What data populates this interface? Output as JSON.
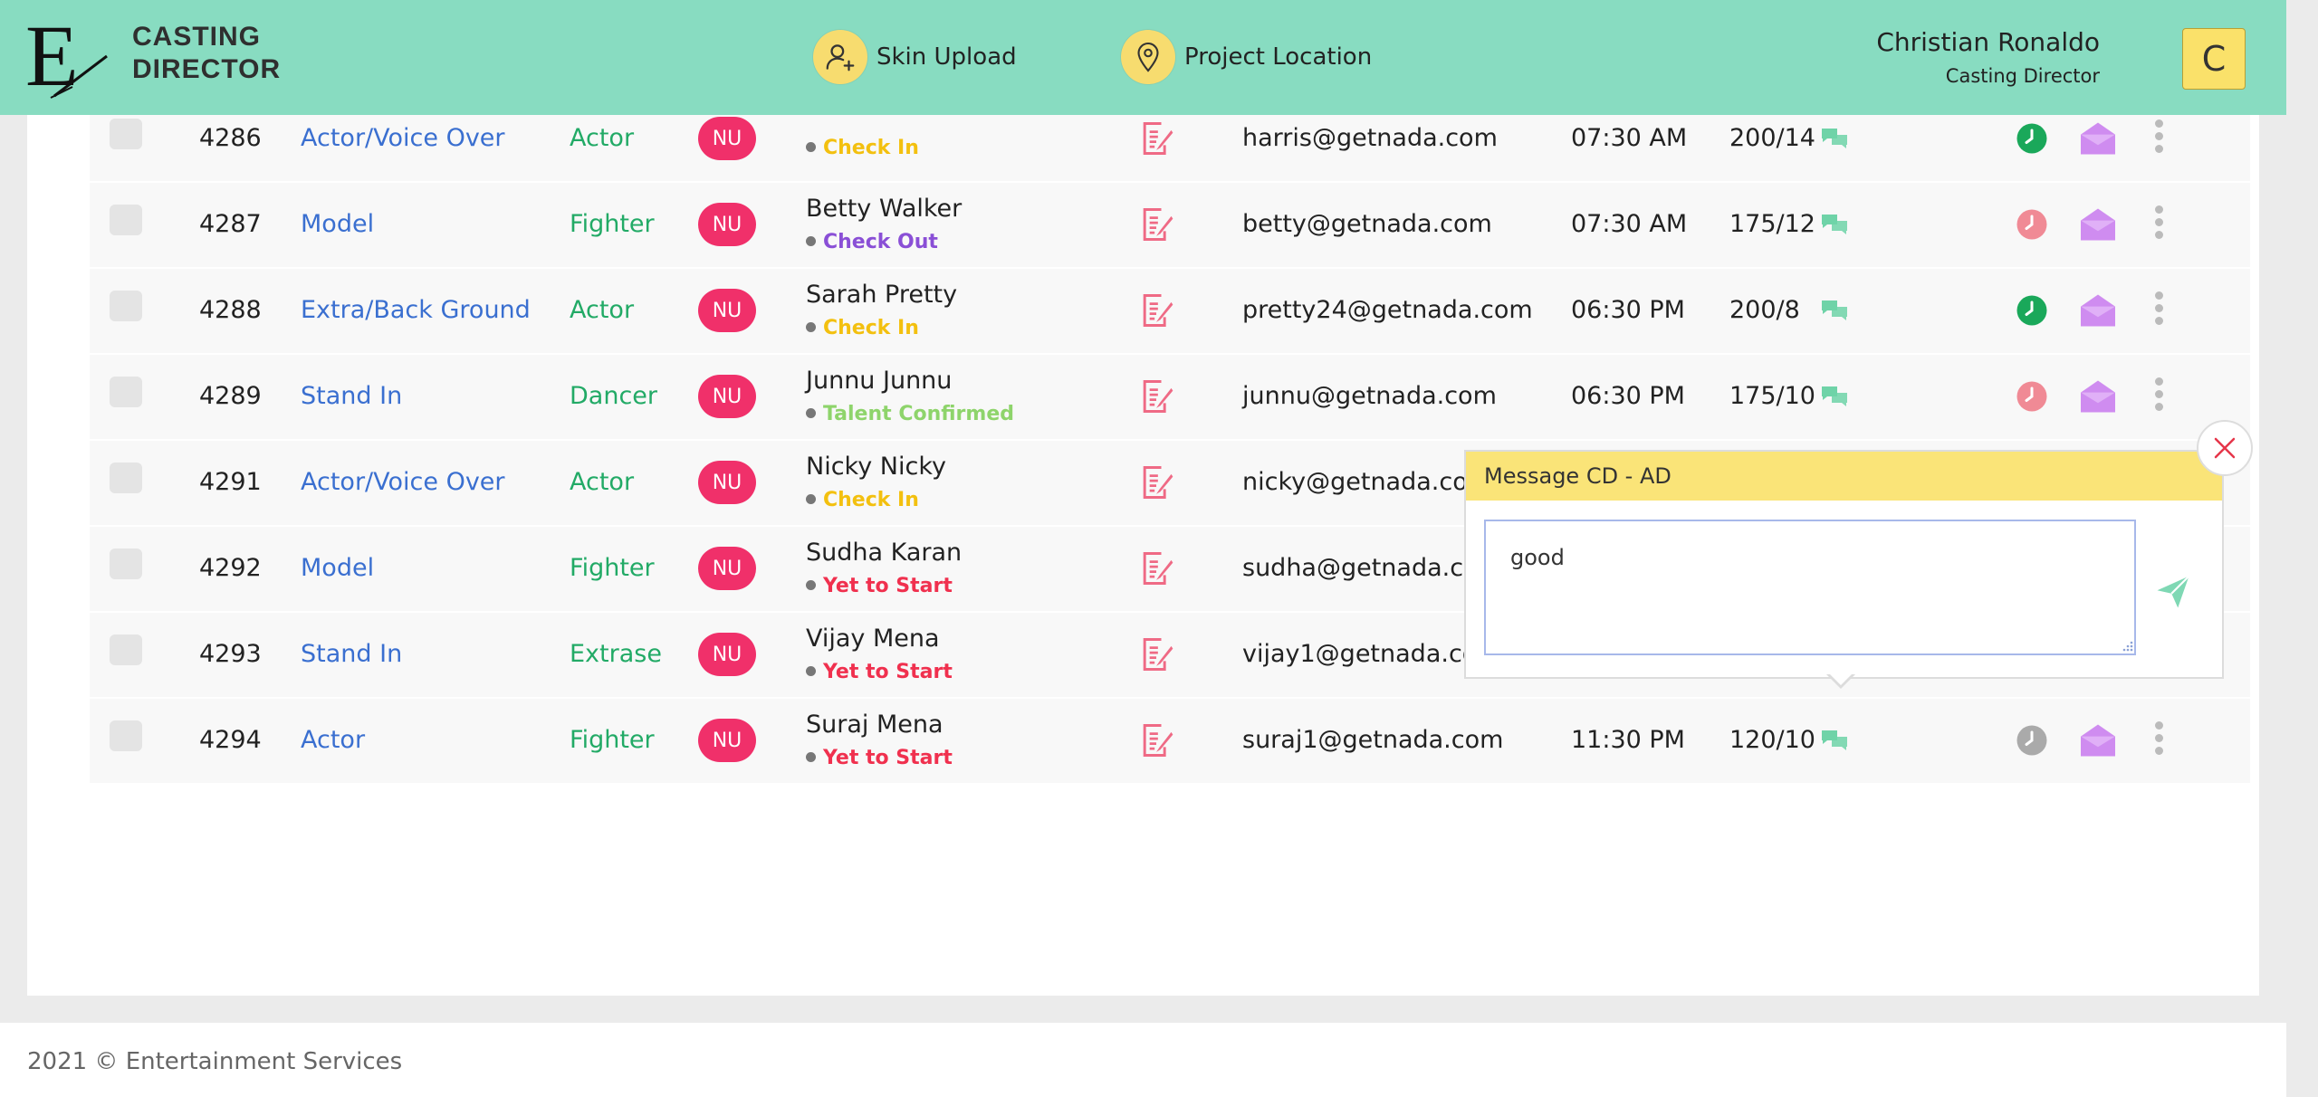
{
  "brand": {
    "logo_letter": "E",
    "line1": "CASTING",
    "line2": "DIRECTOR"
  },
  "nav": {
    "skin_upload": "Skin Upload",
    "project_location": "Project Location"
  },
  "user": {
    "name": "Christian Ronaldo",
    "role": "Casting Director",
    "initial": "C"
  },
  "colors": {
    "header_bg": "#88dcc1",
    "badge": "#f0306a",
    "category": "#3a6fd0",
    "role": "#22aa66",
    "check_in": "#f3c00f",
    "check_out": "#8a4fd6",
    "talent_confirmed": "#8ed46b",
    "yet_to_start": "#f0304e"
  },
  "rows": [
    {
      "id": "4286",
      "category": "Actor/Voice Over",
      "role": "Actor",
      "badge": "NU",
      "name": "",
      "status": "Check In",
      "status_color": "#f3c00f",
      "email": "harris@getnada.com",
      "time": "07:30 AM",
      "ratio": "200/14",
      "clock_color": "#1aa85a"
    },
    {
      "id": "4287",
      "category": "Model",
      "role": "Fighter",
      "badge": "NU",
      "name": "Betty Walker",
      "status": "Check Out",
      "status_color": "#8a4fd6",
      "email": "betty@getnada.com",
      "time": "07:30 AM",
      "ratio": "175/12",
      "clock_color": "#f08a95"
    },
    {
      "id": "4288",
      "category": "Extra/Back Ground",
      "role": "Actor",
      "badge": "NU",
      "name": "Sarah Pretty",
      "status": "Check In",
      "status_color": "#f3c00f",
      "email": "pretty24@getnada.com",
      "time": "06:30 PM",
      "ratio": "200/8",
      "clock_color": "#1aa85a"
    },
    {
      "id": "4289",
      "category": "Stand In",
      "role": "Dancer",
      "badge": "NU",
      "name": "Junnu Junnu",
      "status": "Talent Confirmed",
      "status_color": "#8ed46b",
      "email": "junnu@getnada.com",
      "time": "06:30 PM",
      "ratio": "175/10",
      "clock_color": "#f08a95"
    },
    {
      "id": "4291",
      "category": "Actor/Voice Over",
      "role": "Actor",
      "badge": "NU",
      "name": "Nicky Nicky",
      "status": "Check In",
      "status_color": "#f3c00f",
      "email": "nicky@getnada.com",
      "time": "",
      "ratio": "",
      "clock_color": "#aaaaaa"
    },
    {
      "id": "4292",
      "category": "Model",
      "role": "Fighter",
      "badge": "NU",
      "name": "Sudha Karan",
      "status": "Yet to Start",
      "status_color": "#f0304e",
      "email": "sudha@getnada.com",
      "time": "",
      "ratio": "",
      "clock_color": "#aaaaaa"
    },
    {
      "id": "4293",
      "category": "Stand In",
      "role": "Extrase",
      "badge": "NU",
      "name": "Vijay Mena",
      "status": "Yet to Start",
      "status_color": "#f0304e",
      "email": "vijay1@getnada.com",
      "time": "",
      "ratio": "",
      "clock_color": "#aaaaaa"
    },
    {
      "id": "4294",
      "category": "Actor",
      "role": "Fighter",
      "badge": "NU",
      "name": "Suraj Mena",
      "status": "Yet to Start",
      "status_color": "#f0304e",
      "email": "suraj1@getnada.com",
      "time": "11:30 PM",
      "ratio": "120/10",
      "clock_color": "#aaaaaa"
    }
  ],
  "popup": {
    "title": "Message CD - AD",
    "message": "good"
  },
  "footer": {
    "text": "2021 © Entertainment Services"
  },
  "icons": {
    "skin_upload": "user-add-icon",
    "project_location": "map-pin-icon",
    "document": "edit-document-icon",
    "chat": "chat-bubbles-icon",
    "clock": "clock-icon",
    "mail": "open-envelope-icon",
    "more": "kebab-menu-icon",
    "send": "send-icon",
    "close": "close-icon"
  }
}
